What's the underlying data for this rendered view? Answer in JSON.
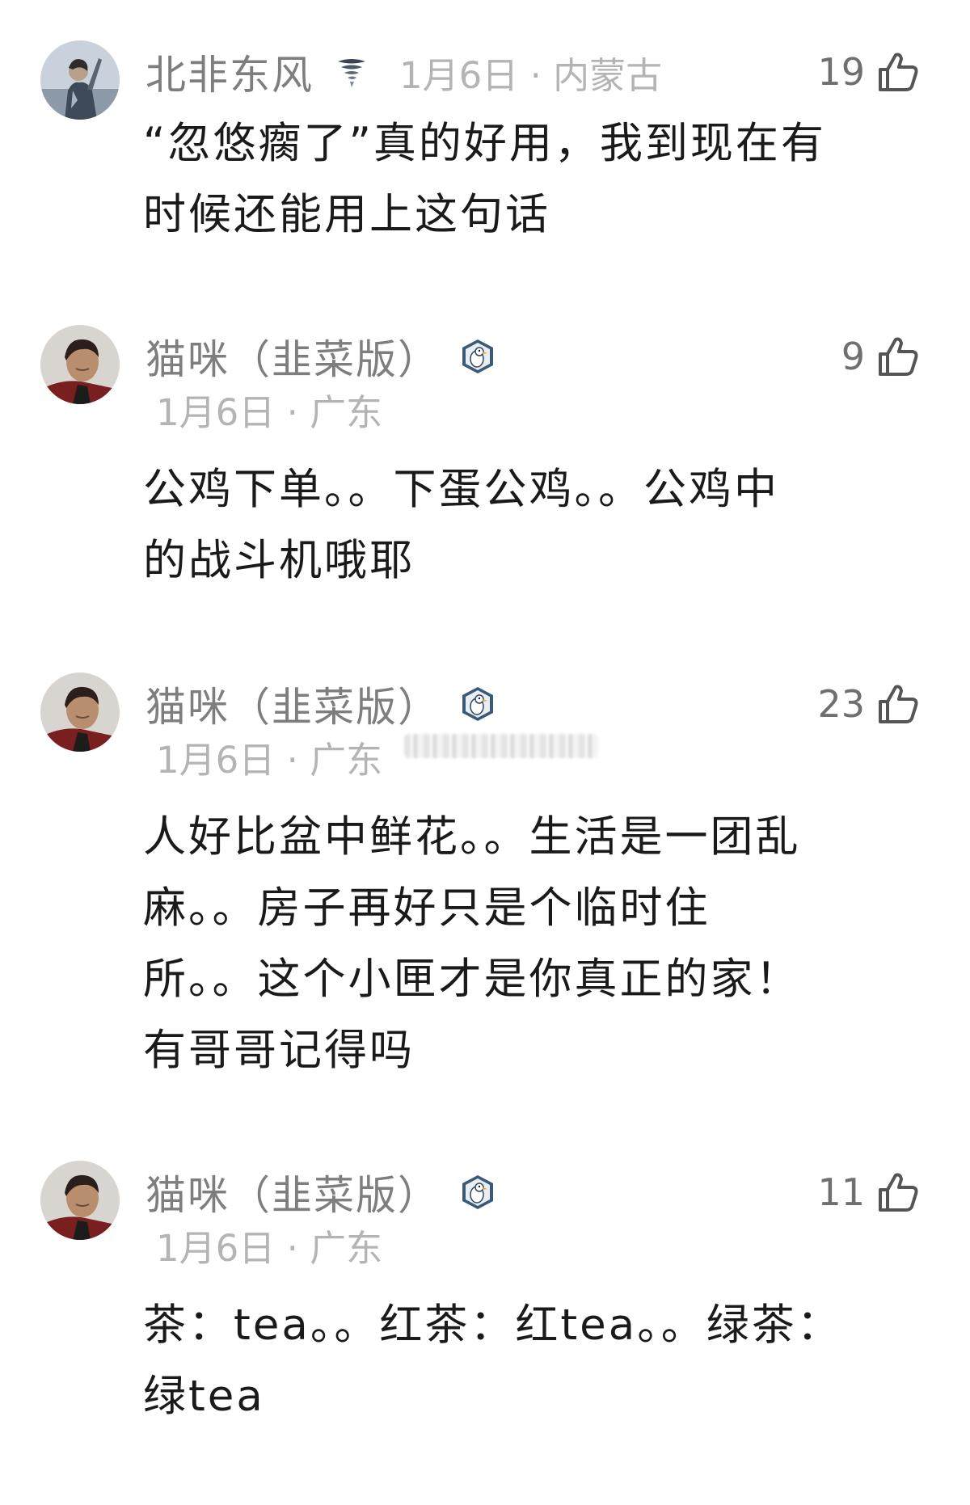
{
  "comments": [
    {
      "user": "北非东风",
      "badge_icon": "tornado-icon",
      "date": "1月6日",
      "location": "内蒙古",
      "meta": "1月6日 · 内蒙古",
      "likes": "19",
      "text_lines": [
        "“忽悠瘸了”真的好用，我到现在有",
        "时候还能用上这句话"
      ]
    },
    {
      "user": "猫咪（韭菜版）",
      "badge_icon": "goose-badge-icon",
      "date": "1月6日",
      "location": "广东",
      "meta": "1月6日 · 广东",
      "likes": "9",
      "text_lines": [
        "公鸡下单。。下蛋公鸡。。公鸡中",
        "的战斗机哦耶"
      ]
    },
    {
      "user": "猫咪（韭菜版）",
      "badge_icon": "goose-badge-icon",
      "date": "1月6日",
      "location": "广东",
      "meta": "1月6日 · 广东",
      "likes": "23",
      "text_lines": [
        "人好比盆中鲜花。。生活是一团乱",
        "麻。。房子再好只是个临时住",
        "所。。这个小匣才是你真正的家！",
        "有哥哥记得吗"
      ]
    },
    {
      "user": "猫咪（韭菜版）",
      "badge_icon": "goose-badge-icon",
      "date": "1月6日",
      "location": "广东",
      "meta": "1月6日 · 广东",
      "likes": "11",
      "text_lines": [
        "茶：tea。。红茶：红tea。。绿茶：",
        "绿tea"
      ]
    }
  ],
  "colors": {
    "username": "#7e7e7e",
    "meta": "#b4b4b4",
    "body": "#1a1a1a",
    "like_count": "#6f6f6f"
  }
}
